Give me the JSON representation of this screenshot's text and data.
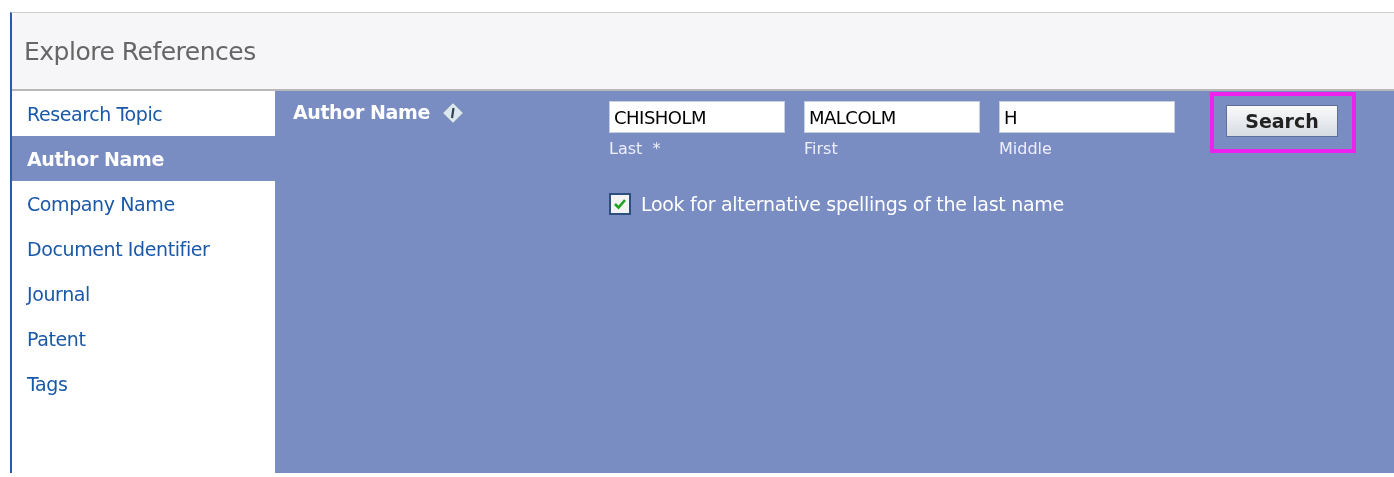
{
  "header": {
    "title": "Explore References"
  },
  "sidebar": {
    "items": [
      {
        "label": "Research Topic",
        "selected": false
      },
      {
        "label": "Author Name",
        "selected": true
      },
      {
        "label": "Company Name",
        "selected": false
      },
      {
        "label": "Document Identifier",
        "selected": false
      },
      {
        "label": "Journal",
        "selected": false
      },
      {
        "label": "Patent",
        "selected": false
      },
      {
        "label": "Tags",
        "selected": false
      }
    ]
  },
  "form": {
    "title": "Author Name",
    "fields": [
      {
        "value": "CHISHOLM",
        "label": "Last  *"
      },
      {
        "value": "MALCOLM",
        "label": "First"
      },
      {
        "value": "H",
        "label": "Middle"
      }
    ],
    "search_button": {
      "label": "Search",
      "highlighted": true
    },
    "alternative_spellings": {
      "label": "Look for alternative spellings of the last name",
      "checked": true
    }
  }
}
